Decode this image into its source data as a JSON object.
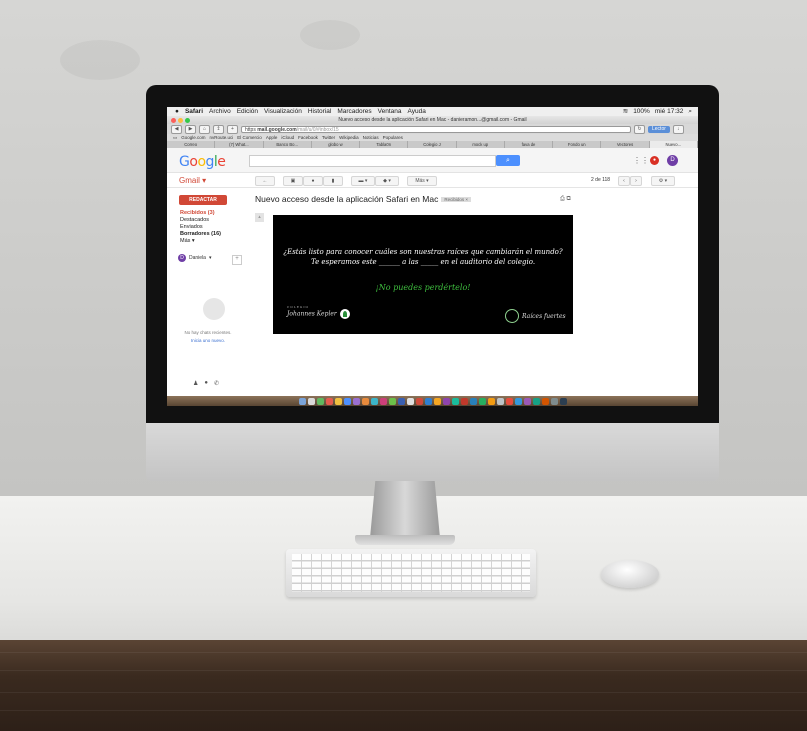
{
  "mac": {
    "app": "Safari",
    "menus": [
      "Archivo",
      "Edición",
      "Visualización",
      "Historial",
      "Marcadores",
      "Ventana",
      "Ayuda"
    ],
    "status": "100%",
    "clock": "mié 17:32",
    "window_title": "Nuevo acceso desde la aplicación Safari en Mac - danieramon...@gmail.com - Gmail"
  },
  "browser": {
    "url_host": "mail.google.com",
    "url_prefix": "https",
    "url_path": "/mail/u/0/#inbox/15",
    "reader_label": "Lector",
    "bookmarks": [
      "Google.com",
      "nvRoute.uci",
      "El Comercio",
      "Apple",
      "iCloud",
      "Facebook",
      "Twitter",
      "Wikipedia",
      "Noticias",
      "Populares"
    ],
    "tabs": [
      "Correo",
      "(7) What...",
      "Banco Bo...",
      "globo w",
      "Tabla0n",
      "Colegio J",
      "mock up",
      "fava de",
      "Fondo un",
      "Vectores",
      "Nuevo..."
    ]
  },
  "gmail": {
    "logo": "Google",
    "label": "Gmail",
    "search_button": "🔍",
    "compose": "REDACTAR",
    "nav": [
      {
        "label": "Recibidos (3)",
        "state": "selected"
      },
      {
        "label": "Destacados",
        "state": ""
      },
      {
        "label": "Enviados",
        "state": ""
      },
      {
        "label": "Borradores (16)",
        "state": "bold"
      },
      {
        "label": "Más",
        "state": ""
      }
    ],
    "chat_user": "Daniela",
    "no_chats": "No hay chats recientes.",
    "start_chat": "Inicia uno nuevo.",
    "pager": "2 de 118",
    "more_label": "Más",
    "subject": "Nuevo acceso desde la aplicación Safari en Mac",
    "subject_tag": "Recibidos"
  },
  "poster": {
    "question_line1": "¿Estás listo para conocer cuáles son nuestras raíces que cambiarán el mundo?",
    "question_line2": "Te esperamos este ______ a las _____ en el auditorio del colegio.",
    "cta": "¡No puedes perdértelo!",
    "logo_left_small": "COLEGIO",
    "logo_left": "Johannes Kepler",
    "logo_right": "Raíces fuertes"
  },
  "colors": {
    "gmail_red": "#d14836",
    "search_blue": "#4d90fe",
    "poster_green": "#3fbf3f"
  }
}
